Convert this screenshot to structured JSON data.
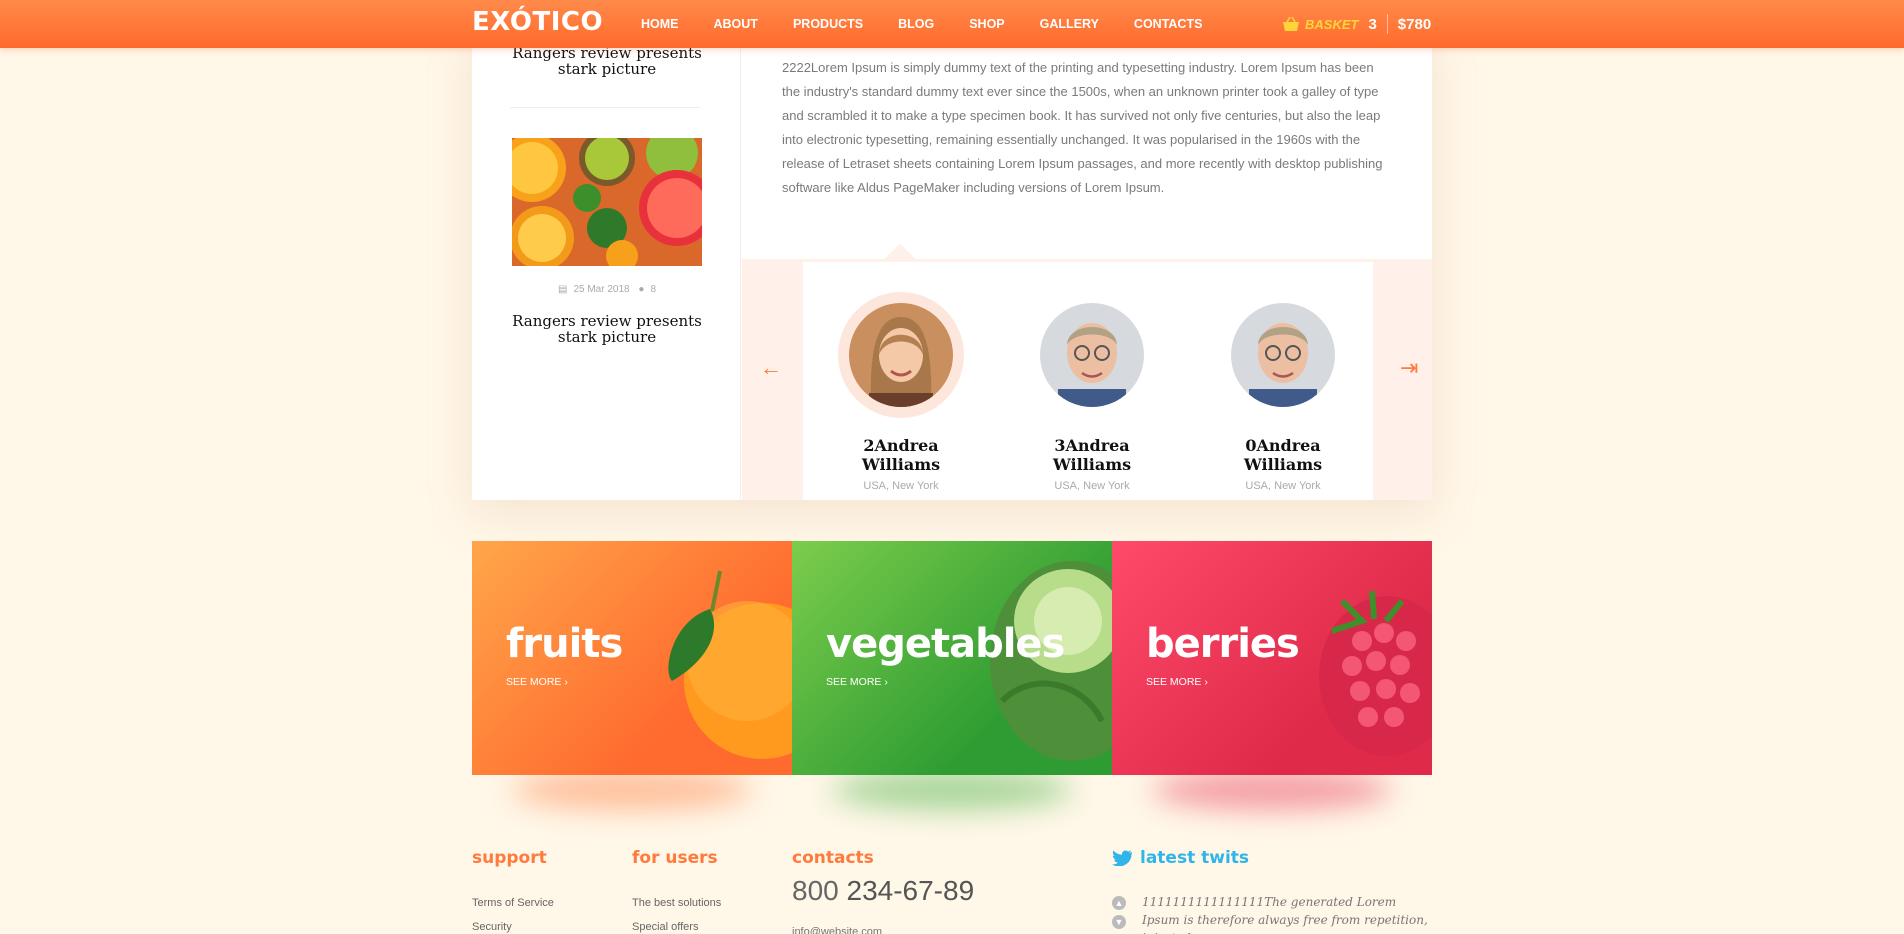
{
  "header": {
    "logo": "EXÓTICO",
    "nav": [
      "HOME",
      "ABOUT",
      "PRODUCTS",
      "BLOG",
      "SHOP",
      "GALLERY",
      "CONTACTS"
    ],
    "basket_label": "BASKET",
    "basket_count": "3",
    "basket_total": "$780",
    "colors": {
      "primary": "#ff7a3c",
      "basket": "#ffd43a"
    }
  },
  "sidebar": {
    "posts": [
      {
        "title": "Rangers review presents stark picture"
      },
      {
        "title": "Rangers review presents stark picture",
        "date": "25 Mar 2018",
        "comments": "8"
      }
    ]
  },
  "article": {
    "text": "2222Lorem Ipsum is simply dummy text of the printing and typesetting industry. Lorem Ipsum has been the industry's standard dummy text ever since the 1500s, when an unknown printer took a galley of type and scrambled it to make a type specimen book. It has survived not only five centuries, but also the leap into electronic typesetting, remaining essentially unchanged. It was popularised in the 1960s with the release of Letraset sheets containing Lorem Ipsum passages, and more recently with desktop publishing software like Aldus PageMaker including versions of Lorem Ipsum."
  },
  "testimonials": [
    {
      "name": "2Andrea Williams",
      "location": "USA, New York",
      "active": true
    },
    {
      "name": "3Andrea Williams",
      "location": "USA, New York",
      "active": false
    },
    {
      "name": "0Andrea Williams",
      "location": "USA, New York",
      "active": false
    }
  ],
  "categories": [
    {
      "title": "fruits",
      "more": "SEE MORE  ›",
      "color": "#ff7a3c"
    },
    {
      "title": "vegetables",
      "more": "SEE MORE  ›",
      "color": "#3fae3a"
    },
    {
      "title": "berries",
      "more": "SEE MORE  ›",
      "color": "#e8304f"
    }
  ],
  "footer": {
    "support": {
      "title": "support",
      "links": [
        "Terms of Service",
        "Security"
      ]
    },
    "users": {
      "title": "for users",
      "links": [
        "The best solutions",
        "Special offers"
      ]
    },
    "contacts": {
      "title": "contacts",
      "phone_prefix": "800",
      "phone": "234-67-89",
      "email": "info@website.com"
    },
    "twits": {
      "title": "latest twits",
      "text": "1111111111111111The generated Lorem Ipsum is therefore always free from repetition, injected"
    }
  }
}
